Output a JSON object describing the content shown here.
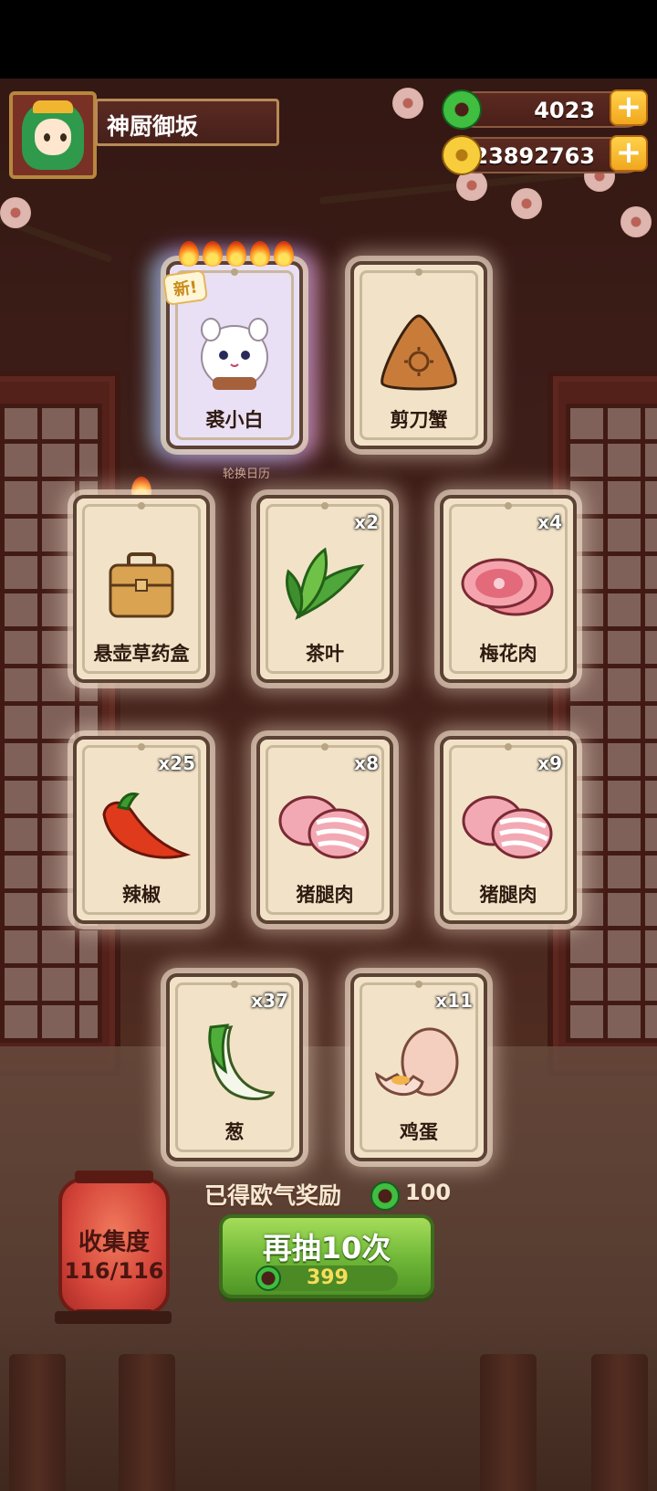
{
  "player": {
    "name": "神厨御坂",
    "avatar_icon": "green-hair-girl-avatar"
  },
  "resources": {
    "jade": {
      "value": "4023",
      "icon": "jade-disc-icon"
    },
    "coins": {
      "value": "23892763",
      "icon": "gold-coin-icon"
    }
  },
  "rare_row": [
    {
      "label": "裘小白",
      "icon": "white-cat-icon",
      "flames": 5,
      "badge": "新!",
      "caption": "轮换日历"
    },
    {
      "label": "剪刀蟹",
      "icon": "crab-icon"
    }
  ],
  "cards": [
    {
      "label": "悬壶草药盒",
      "icon": "herb-box-icon",
      "count": "",
      "flames": 1
    },
    {
      "label": "茶叶",
      "icon": "tea-leaf-icon",
      "count": "x2"
    },
    {
      "label": "梅花肉",
      "icon": "pork-shoulder-icon",
      "count": "x4"
    },
    {
      "label": "辣椒",
      "icon": "chili-icon",
      "count": "x25"
    },
    {
      "label": "猪腿肉",
      "icon": "pork-leg-icon",
      "count": "x8"
    },
    {
      "label": "猪腿肉",
      "icon": "pork-leg-icon",
      "count": "x9"
    },
    {
      "label": "葱",
      "icon": "scallion-icon",
      "count": "x37"
    },
    {
      "label": "鸡蛋",
      "icon": "egg-icon",
      "count": "x11"
    }
  ],
  "reward": {
    "label": "已得欧气奖励",
    "amount": "100"
  },
  "collection": {
    "title": "收集度",
    "progress": "116/116"
  },
  "draw_button": {
    "label": "再抽10次",
    "cost": "399"
  },
  "colors": {
    "card_bg": "#f2e3c8",
    "button_green": "#6eb637",
    "jade": "#3fbe3f",
    "coin": "#f7cd3b"
  }
}
